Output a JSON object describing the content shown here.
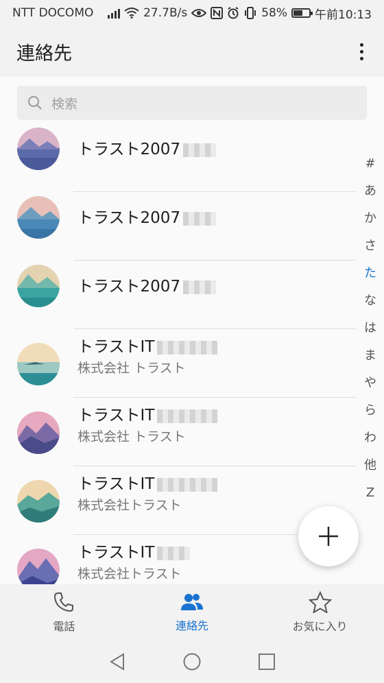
{
  "status_bar": {
    "carrier": "NTT DOCOMO",
    "net_speed": "27.7B/s",
    "battery": "58%",
    "time": "午前10:13"
  },
  "app_bar": {
    "title": "連絡先"
  },
  "search": {
    "placeholder": "検索"
  },
  "contacts": [
    {
      "name": "トラスト2007",
      "company": ""
    },
    {
      "name": "トラスト2007",
      "company": ""
    },
    {
      "name": "トラスト2007",
      "company": ""
    },
    {
      "name": "トラストIT",
      "company": "株式会社 トラスト"
    },
    {
      "name": "トラストIT",
      "company": "株式会社 トラスト"
    },
    {
      "name": "トラストIT",
      "company": "株式会社トラスト"
    },
    {
      "name": "トラストIT",
      "company": "株式会社トラスト"
    }
  ],
  "index_letters": [
    "#",
    "あ",
    "か",
    "さ",
    "た",
    "な",
    "は",
    "ま",
    "や",
    "ら",
    "わ",
    "他",
    "Z"
  ],
  "index_active": "た",
  "bottom_tabs": [
    {
      "label": "電話",
      "icon": "phone-icon"
    },
    {
      "label": "連絡先",
      "icon": "contacts-icon"
    },
    {
      "label": "お気に入り",
      "icon": "star-icon"
    }
  ],
  "colors": {
    "accent": "#1a73d0"
  }
}
